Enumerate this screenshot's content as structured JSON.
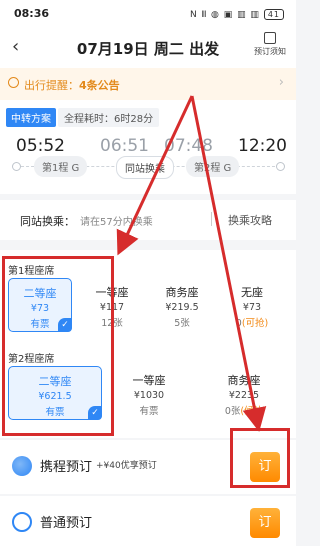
{
  "status_bar": {
    "time": "08:36",
    "icons": "N 𝍫 ◍ ▣ ▥ ▥",
    "battery": "41"
  },
  "header": {
    "back_icon": "back-chevron-icon",
    "title": "07月19日 周二 出发",
    "notice_label": "预订须知"
  },
  "reminder": {
    "label": "出行提醒：",
    "count_text": "4条公告",
    "arrow": "›"
  },
  "route": {
    "tag": "中转方案",
    "duration_label": "全程耗时：",
    "duration": "6时28分",
    "times": [
      "05:52",
      "06:51",
      "07:48",
      "12:20"
    ],
    "leg1": "第1程 G",
    "transfer": "同站换乘",
    "leg2": "第2程 G"
  },
  "transfer_row": {
    "label": "同站换乘：",
    "hint": "请在57分内换乘",
    "tips": "换乘攻略"
  },
  "seats": {
    "leg1_label": "第1程座席",
    "leg1": [
      {
        "name": "二等座",
        "price": "¥73",
        "stock": "有票",
        "selected": true
      },
      {
        "name": "一等座",
        "price": "¥117",
        "stock": "12张"
      },
      {
        "name": "商务座",
        "price": "¥219.5",
        "stock": "5张"
      },
      {
        "name": "无座",
        "price": "¥73",
        "stock": "0",
        "stock_extra": "(可抢)"
      }
    ],
    "leg2_label": "第2程座席",
    "leg2": [
      {
        "name": "二等座",
        "price": "¥621.5",
        "stock": "有票",
        "selected": true
      },
      {
        "name": "一等座",
        "price": "¥1030",
        "stock": "有票"
      },
      {
        "name": "商务座",
        "price": "¥2235",
        "stock": "0张",
        "stock_extra": "(候补"
      }
    ]
  },
  "booking": [
    {
      "name": "携程预订",
      "promo": "+¥40优享预订",
      "button": "订"
    },
    {
      "name": "普通预订",
      "button": "订"
    }
  ],
  "colors": {
    "accent": "#2f87f5",
    "warning": "#e38a1c",
    "annotation": "#d62c2c",
    "order_btn": "#ff9a14"
  }
}
